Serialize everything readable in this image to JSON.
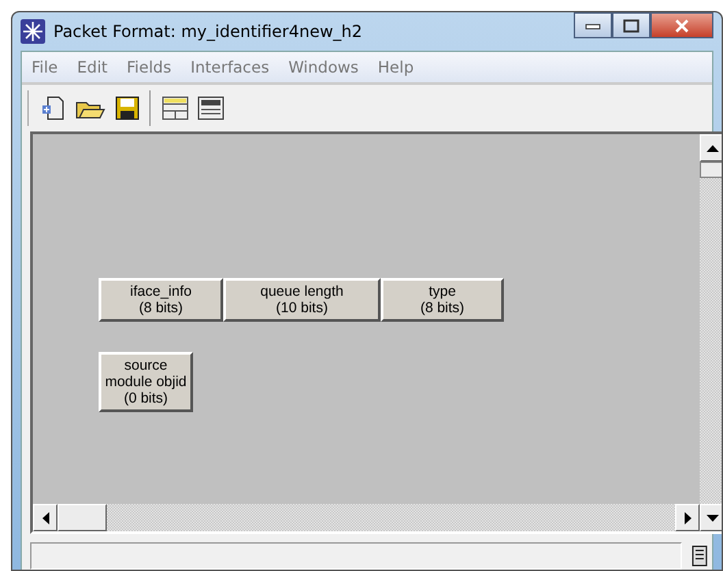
{
  "window": {
    "title": "Packet Format: my_identifier4new_h2"
  },
  "menu": [
    "File",
    "Edit",
    "Fields",
    "Interfaces",
    "Windows",
    "Help"
  ],
  "field_rows": [
    [
      {
        "name": "iface_info",
        "size": "(8 bits)"
      },
      {
        "name": "queue length",
        "size": "(10 bits)"
      },
      {
        "name": "type",
        "size": "(8 bits)"
      }
    ],
    [
      {
        "name": "source module objid",
        "size": "(0 bits)"
      }
    ]
  ]
}
